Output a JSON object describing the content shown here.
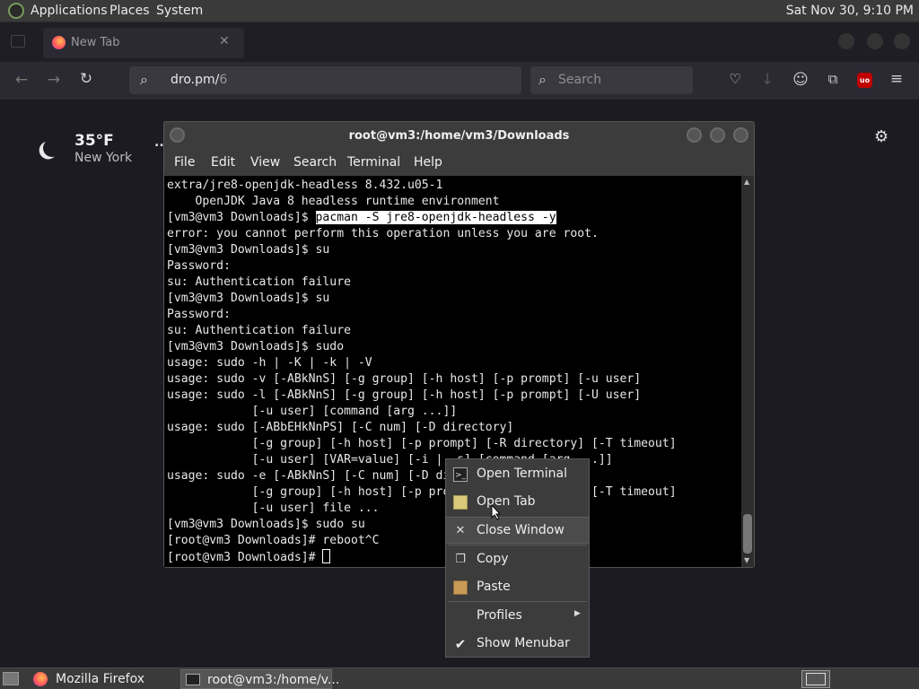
{
  "top_panel": {
    "applications": "Applications",
    "places": "Places",
    "system": "System",
    "clock": "Sat Nov 30,  9:10 PM"
  },
  "browser": {
    "tab_title": "New Tab",
    "url": "dro.pm/",
    "url_suffix": "6",
    "search_placeholder": "Search"
  },
  "weather": {
    "temperature": "35°F",
    "location": "New York",
    "more": ".."
  },
  "terminal": {
    "title": "root@vm3:/home/vm3/Downloads",
    "menu": [
      "File",
      "Edit",
      "View",
      "Search",
      "Terminal",
      "Help"
    ],
    "lines": [
      "extra/jre8-openjdk-headless 8.432.u05-1",
      "    OpenJDK Java 8 headless runtime environment",
      "error: you cannot perform this operation unless you are root.",
      "[vm3@vm3 Downloads]$ su",
      "Password:",
      "su: Authentication failure",
      "[vm3@vm3 Downloads]$ su",
      "Password:",
      "su: Authentication failure",
      "[vm3@vm3 Downloads]$ sudo",
      "usage: sudo -h | -K | -k | -V",
      "usage: sudo -v [-ABkNnS] [-g group] [-h host] [-p prompt] [-u user]",
      "usage: sudo -l [-ABkNnS] [-g group] [-h host] [-p prompt] [-U user]",
      "            [-u user] [command [arg ...]]",
      "usage: sudo [-ABbEHkNnPS] [-C num] [-D directory]",
      "            [-g group] [-h host] [-p prompt] [-R directory] [-T timeout]",
      "            [-u user] [VAR=value] [-i | -s] [command [arg ...]]",
      "usage: sudo -e [-ABkNnS] [-C num] [-D directory]",
      "            [-g group] [-h host] [-p prompt] [-R directory] [-T timeout]",
      "            [-u user] file ...",
      "[vm3@vm3 Downloads]$ sudo su",
      "[root@vm3 Downloads]# reboot^C"
    ],
    "prompt_highlighted": "[vm3@vm3 Downloads]$ ",
    "highlighted_command": "pacman -S jre8-openjdk-headless -y",
    "current_prompt": "[root@vm3 Downloads]# "
  },
  "context_menu": {
    "items": [
      {
        "label": "Open Terminal",
        "icon": "terminal-icon"
      },
      {
        "label": "Open Tab",
        "icon": "folder-tab-icon"
      },
      {
        "label": "Close Window",
        "icon": "close-icon"
      },
      {
        "label": "Copy",
        "icon": "copy-icon"
      },
      {
        "label": "Paste",
        "icon": "paste-icon"
      },
      {
        "label": "Profiles",
        "icon": "submenu-arrow-icon"
      },
      {
        "label": "Show Menubar",
        "icon": "checkmark-icon"
      }
    ]
  },
  "taskbar": {
    "firefox": "Mozilla Firefox",
    "terminal": "root@vm3:/home/v..."
  },
  "colors": {
    "panel": "#3a3a3a",
    "browser_bg": "#1c1b22",
    "terminal_bg": "#000000",
    "ublock": "#c00000"
  }
}
